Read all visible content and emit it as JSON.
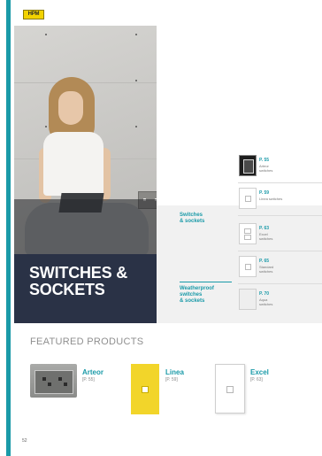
{
  "brand": {
    "logo_text": "HPM"
  },
  "hero": {
    "title_lines": [
      "SWITCHES &",
      "SOCKETS"
    ]
  },
  "categories": [
    {
      "lines": [
        "Switches",
        "& sockets"
      ]
    },
    {
      "lines": [
        "Weatherproof",
        "switches",
        "& sockets"
      ]
    }
  ],
  "products": [
    {
      "ref": "P. 55",
      "name_lines": [
        "Arteor",
        "switches"
      ]
    },
    {
      "ref": "P. 59",
      "name_lines": [
        "Linea switches"
      ]
    },
    {
      "ref": "P. 63",
      "name_lines": [
        "Excel",
        "switches"
      ]
    },
    {
      "ref": "P. 65",
      "name_lines": [
        "Standard",
        "switches"
      ]
    },
    {
      "ref": "P. 70",
      "name_lines": [
        "Aqua",
        "switches"
      ]
    }
  ],
  "featured": {
    "title": "FEATURED PRODUCTS",
    "items": [
      {
        "name": "Arteor",
        "ref": "[P. 55]"
      },
      {
        "name": "Linea",
        "ref": "[P. 59]"
      },
      {
        "name": "Excel",
        "ref": "[P. 63]"
      }
    ]
  },
  "page_number": "52",
  "colors": {
    "accent_teal": "#1a9aa8",
    "linea_yellow": "#f2d52a",
    "hero_overlay": "#282a2c"
  }
}
